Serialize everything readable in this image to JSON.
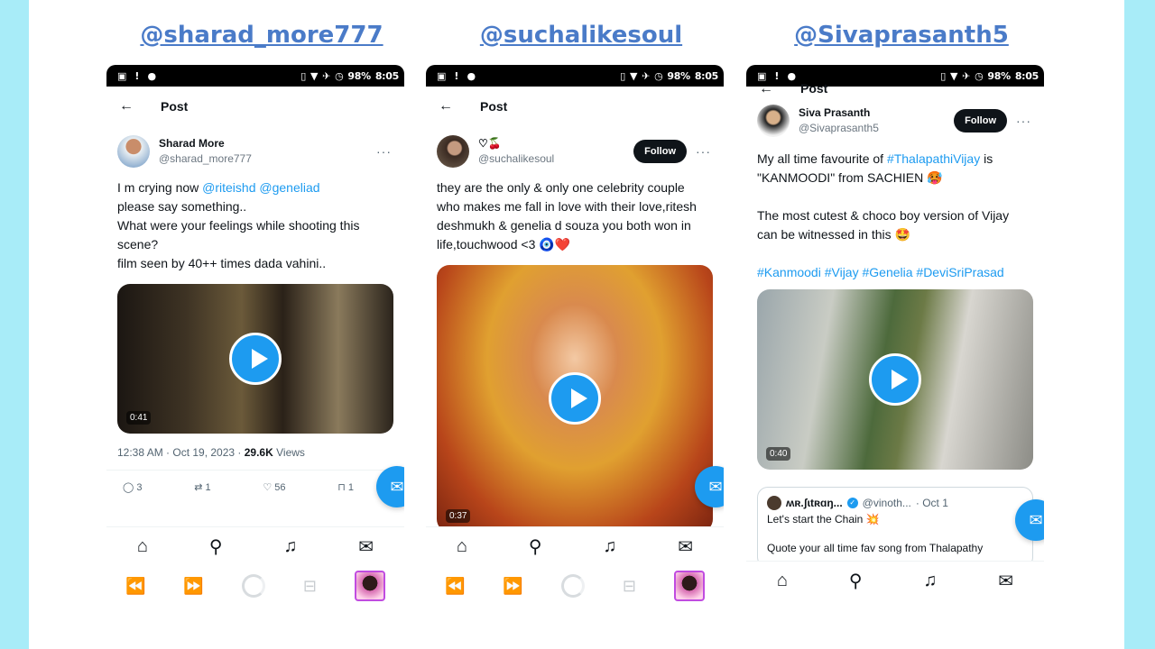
{
  "handles": [
    "@sharad_more777",
    "@suchalikesoul",
    "@Sivaprasanth5"
  ],
  "status_bar": {
    "battery": "98%",
    "time": "8:05"
  },
  "phones": [
    {
      "header": "Post",
      "author": {
        "display_name": "Sharad More",
        "username": "@sharad_more777"
      },
      "text": {
        "l1_pre": "I m crying now ",
        "l1_link": "@riteishd @geneliad",
        "l2": "please say something..",
        "l3": "What were your feelings while shooting this scene?",
        "l4": "film seen by 40++ times dada vahini.."
      },
      "video_duration": "0:41",
      "meta": {
        "timestamp": "12:38 AM · Oct 19, 2023 · ",
        "views_count": "29.6K",
        "views_label": " Views"
      },
      "stats": {
        "replies": "3",
        "reposts": "1",
        "likes": "56",
        "bookmarks": "1"
      }
    },
    {
      "header": "Post",
      "author": {
        "display_name": "♡🍒",
        "username": "@suchalikesoul"
      },
      "follow_label": "Follow",
      "text": {
        "body": "they are the only & only one celebrity couple who makes me fall in love with their love,ritesh deshmukh & genelia d souza you both won in life,touchwood <3 🧿❤️"
      },
      "video_duration": "0:37"
    },
    {
      "header": "Post",
      "author": {
        "display_name": "Siva Prasanth",
        "username": "@Sivaprasanth5"
      },
      "follow_label": "Follow",
      "text": {
        "l1_pre": "My all time favourite of ",
        "l1_link": "#ThalapathiVijay",
        "l1_post": " is \"KANMOODI\" from SACHIEN 🥵",
        "l2": "The most cutest & choco boy version of Vijay can be witnessed in this 🤩",
        "hashtags": "#Kanmoodi #Vijay #Genelia #DeviSriPrasad"
      },
      "video_duration": "0:40",
      "quote": {
        "name": "ʍʀ.ʃɩtʀɑŋ...",
        "handle": "@vinoth...",
        "date": "· Oct 1",
        "line1": "Let's start the Chain 💥",
        "line2": "Quote your all time fav song from Thalapathy"
      }
    }
  ],
  "icons": {
    "back": "arrow-left-icon",
    "more": "more-horizontal-icon",
    "play": "play-icon",
    "reply": "reply-icon",
    "repost": "repost-icon",
    "like": "heart-icon",
    "bookmark": "bookmark-icon",
    "compose": "new-message-icon",
    "home": "home-icon",
    "search": "search-icon",
    "notifications": "bell-icon",
    "messages": "mail-icon"
  },
  "colors": {
    "accent": "#1d9bf0",
    "handle_text": "#4a7bc8",
    "background": "#a8ecf8"
  }
}
